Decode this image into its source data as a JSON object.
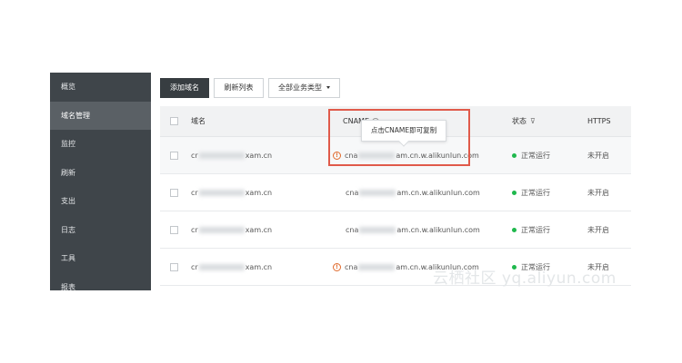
{
  "sidebar": {
    "items": [
      {
        "label": "概览"
      },
      {
        "label": "域名管理",
        "active": true
      },
      {
        "label": "监控"
      },
      {
        "label": "刷新"
      },
      {
        "label": "支出"
      },
      {
        "label": "日志"
      },
      {
        "label": "工具"
      },
      {
        "label": "报表"
      }
    ]
  },
  "toolbar": {
    "add_domain": "添加域名",
    "refresh_list": "刷新列表",
    "business_type": "全部业务类型"
  },
  "table": {
    "headers": {
      "domain": "域名",
      "cname": "CNAME",
      "status": "状态",
      "https": "HTTPS"
    },
    "rows": [
      {
        "domain_prefix": "cr",
        "domain_suffix": "xam.cn",
        "cname_prefix": "cna",
        "cname_suffix": "am.cn.w.alikunlun.com",
        "warning": true,
        "status": "正常运行",
        "https": "未开启"
      },
      {
        "domain_prefix": "cr",
        "domain_suffix": "xam.cn",
        "cname_prefix": "cna",
        "cname_suffix": "am.cn.w.alikunlun.com",
        "warning": false,
        "status": "正常运行",
        "https": "未开启"
      },
      {
        "domain_prefix": "cr",
        "domain_suffix": "xam.cn",
        "cname_prefix": "cna",
        "cname_suffix": "am.cn.w.alikunlun.com",
        "warning": false,
        "status": "正常运行",
        "https": "未开启"
      },
      {
        "domain_prefix": "cr",
        "domain_suffix": "xam.cn",
        "cname_prefix": "cna",
        "cname_suffix": "am.cn.w.alikunlun.com",
        "warning": true,
        "status": "正常运行",
        "https": "未开启"
      }
    ]
  },
  "tooltip": {
    "text": "点击CNAME即可复制"
  },
  "watermark": {
    "text": "云栖社区 yq.aliyun.com"
  },
  "colors": {
    "sidebar_bg": "#3f454a",
    "primary_button": "#373d41",
    "status_ok": "#1fb84d",
    "warning": "#e06a2c",
    "highlight_box": "#e05a4a"
  }
}
